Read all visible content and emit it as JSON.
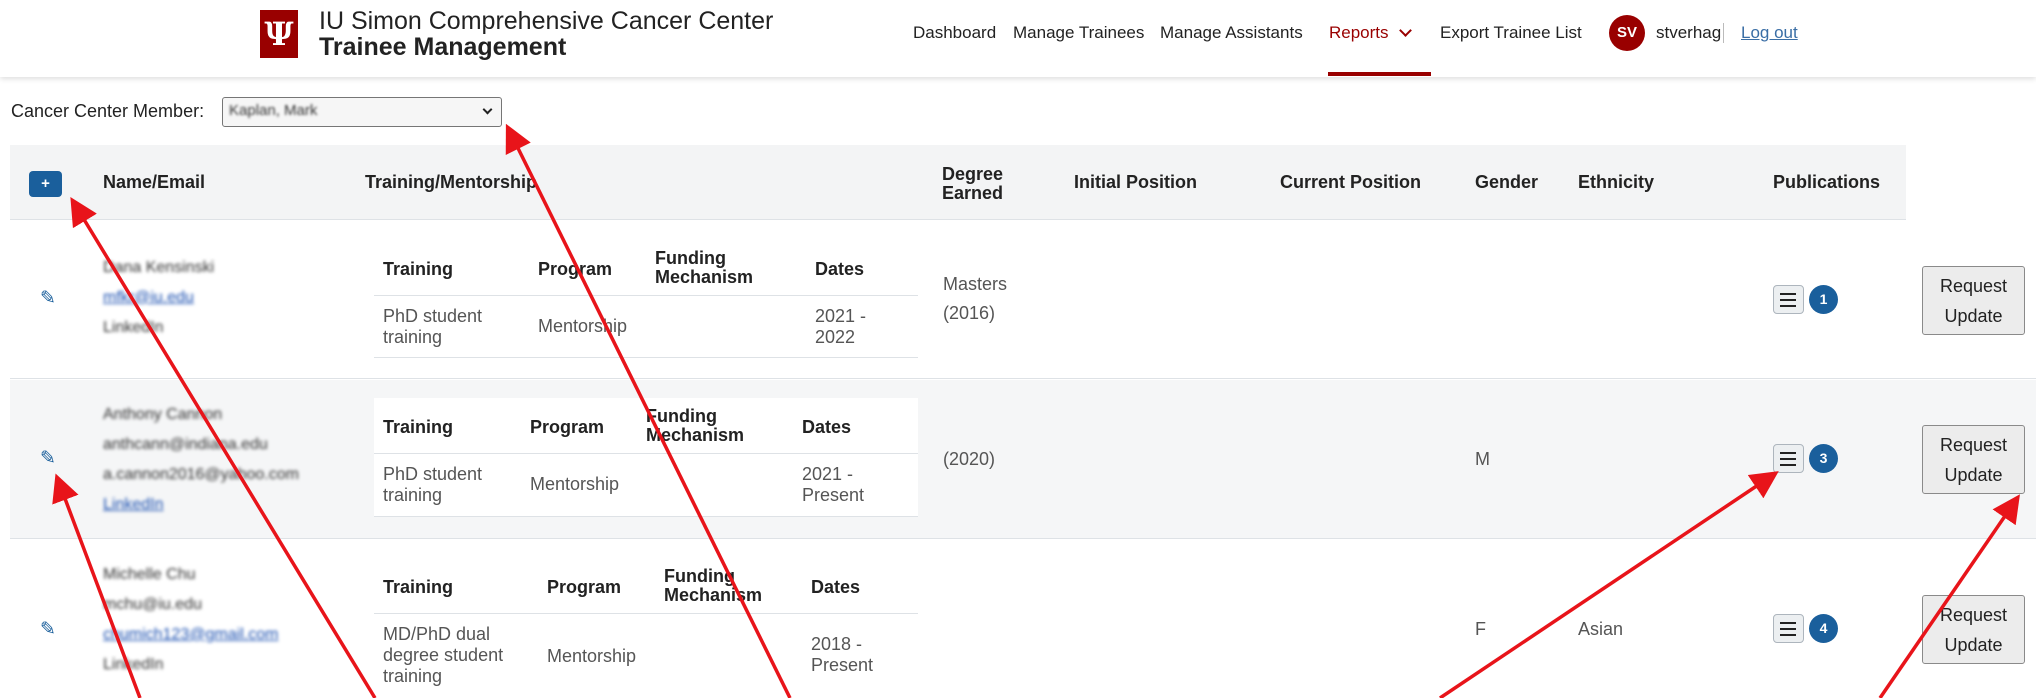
{
  "header": {
    "brand_line1": "IU Simon Comprehensive Cancer Center",
    "brand_line2": "Trainee Management",
    "logo_glyph": "Ψ",
    "nav": {
      "dashboard": "Dashboard",
      "manage_trainees": "Manage Trainees",
      "manage_assistants": "Manage Assistants",
      "reports": "Reports",
      "export_list": "Export Trainee List"
    },
    "user_initials": "SV",
    "username": "stverhag",
    "logout": "Log out"
  },
  "member": {
    "label": "Cancer Center Member:",
    "selected": "Kaplan, Mark"
  },
  "table": {
    "add_symbol": "+",
    "headers": {
      "name": "Name/Email",
      "training": "Training/Mentorship",
      "degree_line1": "Degree",
      "degree_line2": "Earned",
      "initial": "Initial Position",
      "current": "Current Position",
      "gender": "Gender",
      "ethnicity": "Ethnicity",
      "publications": "Publications"
    },
    "inner_headers": {
      "training": "Training",
      "program": "Program",
      "funding_line1": "Funding",
      "funding_line2": "Mechanism",
      "dates": "Dates"
    },
    "rows": [
      {
        "name_lines": [
          "Dana Kensinski",
          "mfkr@iu.edu",
          "LinkedIn"
        ],
        "training_lines": [
          "PhD student",
          "training"
        ],
        "program": "Mentorship",
        "dates_lines": [
          "2021 -",
          "2022"
        ],
        "degree_lines": [
          "Masters",
          "(2016)"
        ],
        "gender": "",
        "ethnicity": "",
        "pub_count": "1",
        "request_line1": "Request",
        "request_line2": "Update"
      },
      {
        "name_lines": [
          "Anthony Cannon",
          "anthcann@indiana.edu",
          "a.cannon2016@yahoo.com",
          "LinkedIn"
        ],
        "training_lines": [
          "PhD student",
          "training"
        ],
        "program": "Mentorship",
        "dates_lines": [
          "2021 -",
          "Present"
        ],
        "degree_lines": [
          "(2020)"
        ],
        "gender": "M",
        "ethnicity": "",
        "pub_count": "3",
        "request_line1": "Request",
        "request_line2": "Update"
      },
      {
        "name_lines": [
          "Michelle Chu",
          "mchu@iu.edu",
          "chumich123@gmail.com",
          "LinkedIn"
        ],
        "training_lines": [
          "MD/PhD dual",
          "degree student",
          "training"
        ],
        "program": "Mentorship",
        "dates_lines": [
          "2018 -",
          "Present"
        ],
        "degree_lines": [],
        "gender": "F",
        "ethnicity": "Asian",
        "pub_count": "4",
        "request_line1": "Request",
        "request_line2": "Update"
      }
    ]
  },
  "colors": {
    "brand_crimson": "#990000",
    "primary_blue": "#1a5f9c",
    "annotation_arrow": "#e8141a"
  }
}
